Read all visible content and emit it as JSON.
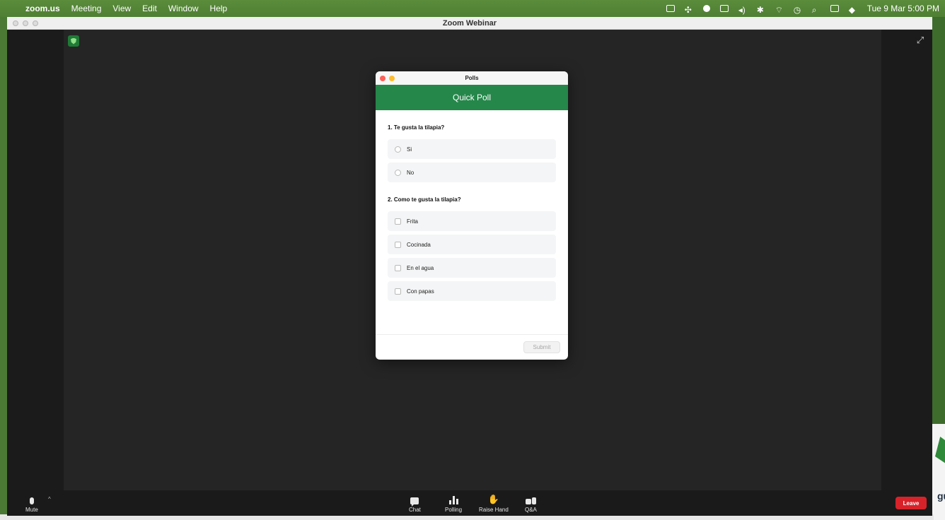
{
  "menubar": {
    "app_name": "zoom.us",
    "menus": [
      "Meeting",
      "View",
      "Edit",
      "Window",
      "Help"
    ],
    "clock": "Tue 9 Mar  5:00 PM"
  },
  "window": {
    "title": "Zoom Webinar"
  },
  "poll_dialog": {
    "window_title": "Polls",
    "header": "Quick Poll",
    "questions": [
      {
        "label": "1. Te gusta la tilapia?",
        "type": "single",
        "options": [
          "Si",
          "No"
        ]
      },
      {
        "label": "2. Como te gusta la tilapia?",
        "type": "multiple",
        "options": [
          "Frita",
          "Cocinada",
          "En el agua",
          "Con papas"
        ]
      }
    ],
    "submit_label": "Submit"
  },
  "toolbar": {
    "mute_label": "Mute",
    "chat_label": "Chat",
    "polling_label": "Polling",
    "raise_hand_label": "Raise Hand",
    "qa_label": "Q&A",
    "leave_label": "Leave"
  },
  "desktop": {
    "side_text": "gu"
  },
  "colors": {
    "poll_header": "#25874a",
    "leave": "#d8222a",
    "close_dot": "#fe5f57",
    "minimize_dot": "#febc2e"
  }
}
